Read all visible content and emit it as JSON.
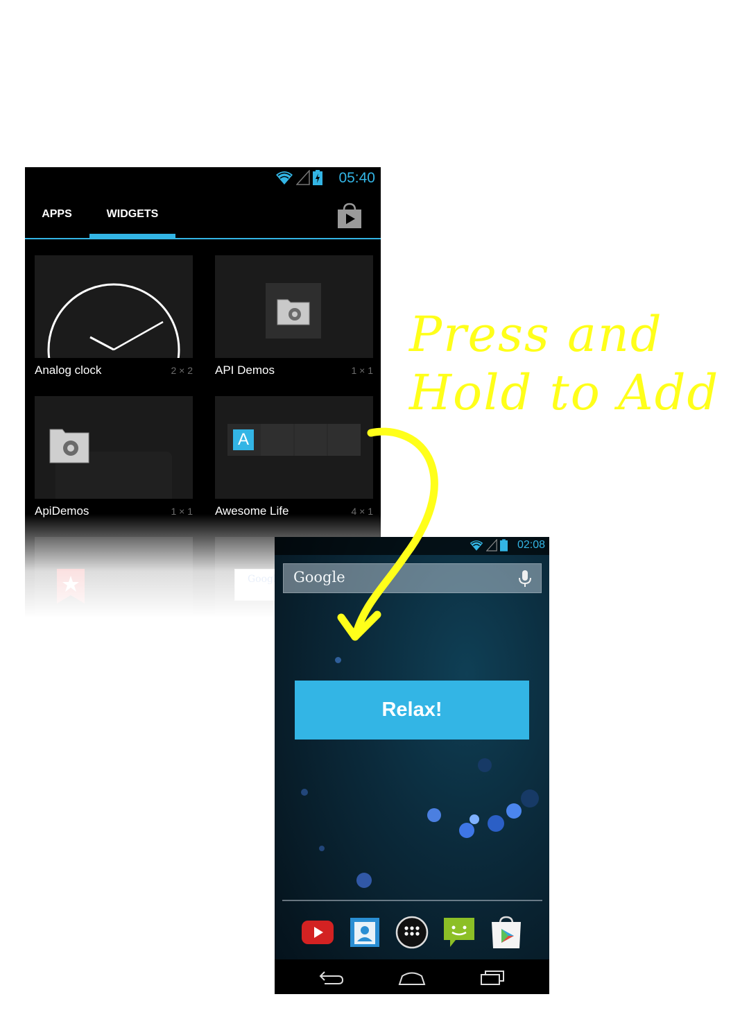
{
  "caption": {
    "line1": "Press and",
    "line2": "Hold to Add"
  },
  "widget_drawer": {
    "status_bar": {
      "time": "05:40",
      "icons": [
        "wifi-icon",
        "signal-icon",
        "battery-charging-icon"
      ]
    },
    "tabs": [
      {
        "label": "APPS",
        "selected": false
      },
      {
        "label": "WIDGETS",
        "selected": true
      }
    ],
    "store_icon": "play-store-bag-icon",
    "widgets": [
      {
        "name": "Analog clock",
        "size": "2 × 2",
        "preview": "analog-clock-icon"
      },
      {
        "name": "API Demos",
        "size": "1 × 1",
        "preview": "settings-folder-icon"
      },
      {
        "name": "ApiDemos",
        "size": "1 × 1",
        "preview": "settings-folder-icon"
      },
      {
        "name": "Awesome Life",
        "size": "4 × 1",
        "preview": "letter-a-tile-icon",
        "preview_letter": "A"
      },
      {
        "name": "",
        "size": "",
        "preview": "bookmark-star-icon"
      },
      {
        "name": "",
        "size": "",
        "preview": "google-search-widget-icon",
        "preview_text": "Google"
      }
    ]
  },
  "home_screen": {
    "status_bar": {
      "time": "02:08",
      "icons": [
        "wifi-icon",
        "signal-icon",
        "battery-icon"
      ]
    },
    "search": {
      "logo_text": "Google",
      "mic_icon": "microphone-icon"
    },
    "widget_button": {
      "label": "Relax!"
    },
    "dock": [
      "youtube-icon",
      "contacts-icon",
      "all-apps-icon",
      "messaging-icon",
      "play-store-icon"
    ],
    "nav_buttons": [
      "back-icon",
      "home-icon",
      "recents-icon"
    ]
  },
  "colors": {
    "accent": "#33b5e5",
    "caption": "#ffff1a",
    "drawer_bg": "#000000",
    "preview_bg": "#1b1b1b"
  }
}
